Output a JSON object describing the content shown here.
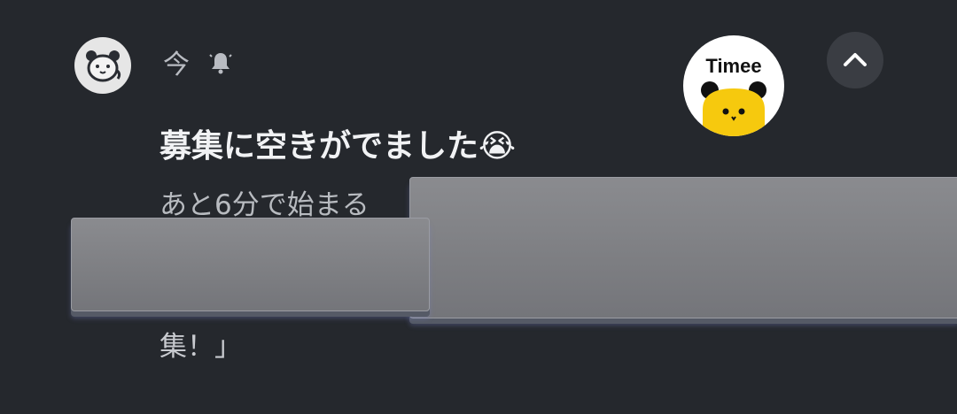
{
  "notification": {
    "app_icon": "panda-face-icon",
    "time": "今",
    "bell_icon": "bell-icon",
    "avatar": {
      "brand": "Timee",
      "mascot_icon": "yellow-panda-mascot-icon",
      "bg_color": "#ffffff",
      "mascot_color": "#f6c90e"
    },
    "collapse_icon": "chevron-up-icon",
    "title": "募集に空きがでました😭",
    "body_line1": "あと6分で始まる",
    "body_line2": "集！」"
  }
}
